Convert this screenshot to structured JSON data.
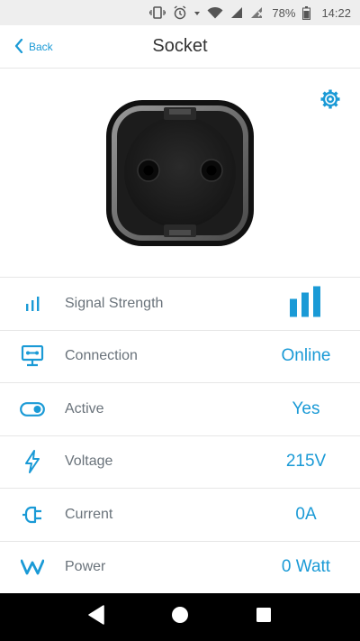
{
  "status_bar": {
    "battery_pct": "78%",
    "time": "14:22"
  },
  "header": {
    "back_label": "Back",
    "title": "Socket"
  },
  "rows": [
    {
      "label": "Signal Strength",
      "icon": "signal-icon"
    },
    {
      "label": "Connection",
      "value": "Online",
      "icon": "connection-icon"
    },
    {
      "label": "Active",
      "value": "Yes",
      "icon": "toggle-icon"
    },
    {
      "label": "Voltage",
      "value": "215V",
      "icon": "lightning-icon"
    },
    {
      "label": "Current",
      "value": "0A",
      "icon": "plug-icon"
    },
    {
      "label": "Power",
      "value": "0 Watt",
      "icon": "watt-icon"
    }
  ],
  "signal_level": "3/3",
  "colors": {
    "accent": "#1a9ad6",
    "label": "#6a737b",
    "divider": "#e6e6e6"
  }
}
